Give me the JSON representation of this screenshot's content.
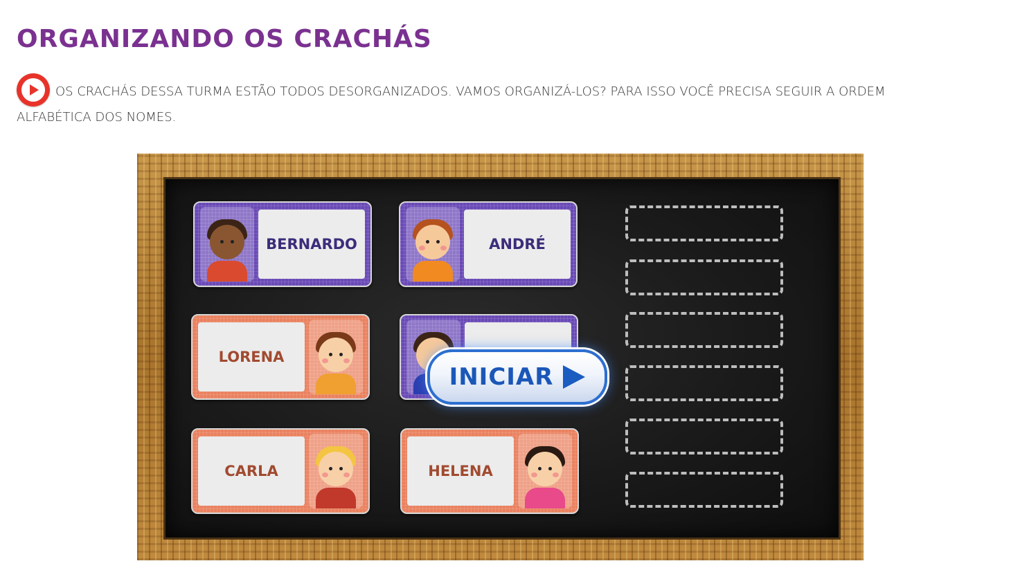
{
  "page": {
    "title": "ORGANIZANDO OS CRACHÁS",
    "instructions": "OS CRACHÁS DESSA TURMA ESTÃO TODOS DESORGANIZADOS. VAMOS ORGANIZÁ-LOS? PARA ISSO VOCÊ PRECISA SEGUIR A ORDEM ALFABÉTICA DOS NOMES.",
    "audio_icon": "play-audio-icon"
  },
  "game": {
    "badges": [
      {
        "name": "BERNARDO",
        "color": "purple"
      },
      {
        "name": "ANDRÉ",
        "color": "purple"
      },
      {
        "name": "LORENA",
        "color": "orange"
      },
      {
        "name": "CARLA",
        "color": "orange"
      },
      {
        "name": "HELENA",
        "color": "orange"
      }
    ],
    "start_button": {
      "label": "INICIAR",
      "icon": "play-arrow-icon"
    },
    "drop_slots": 6
  }
}
